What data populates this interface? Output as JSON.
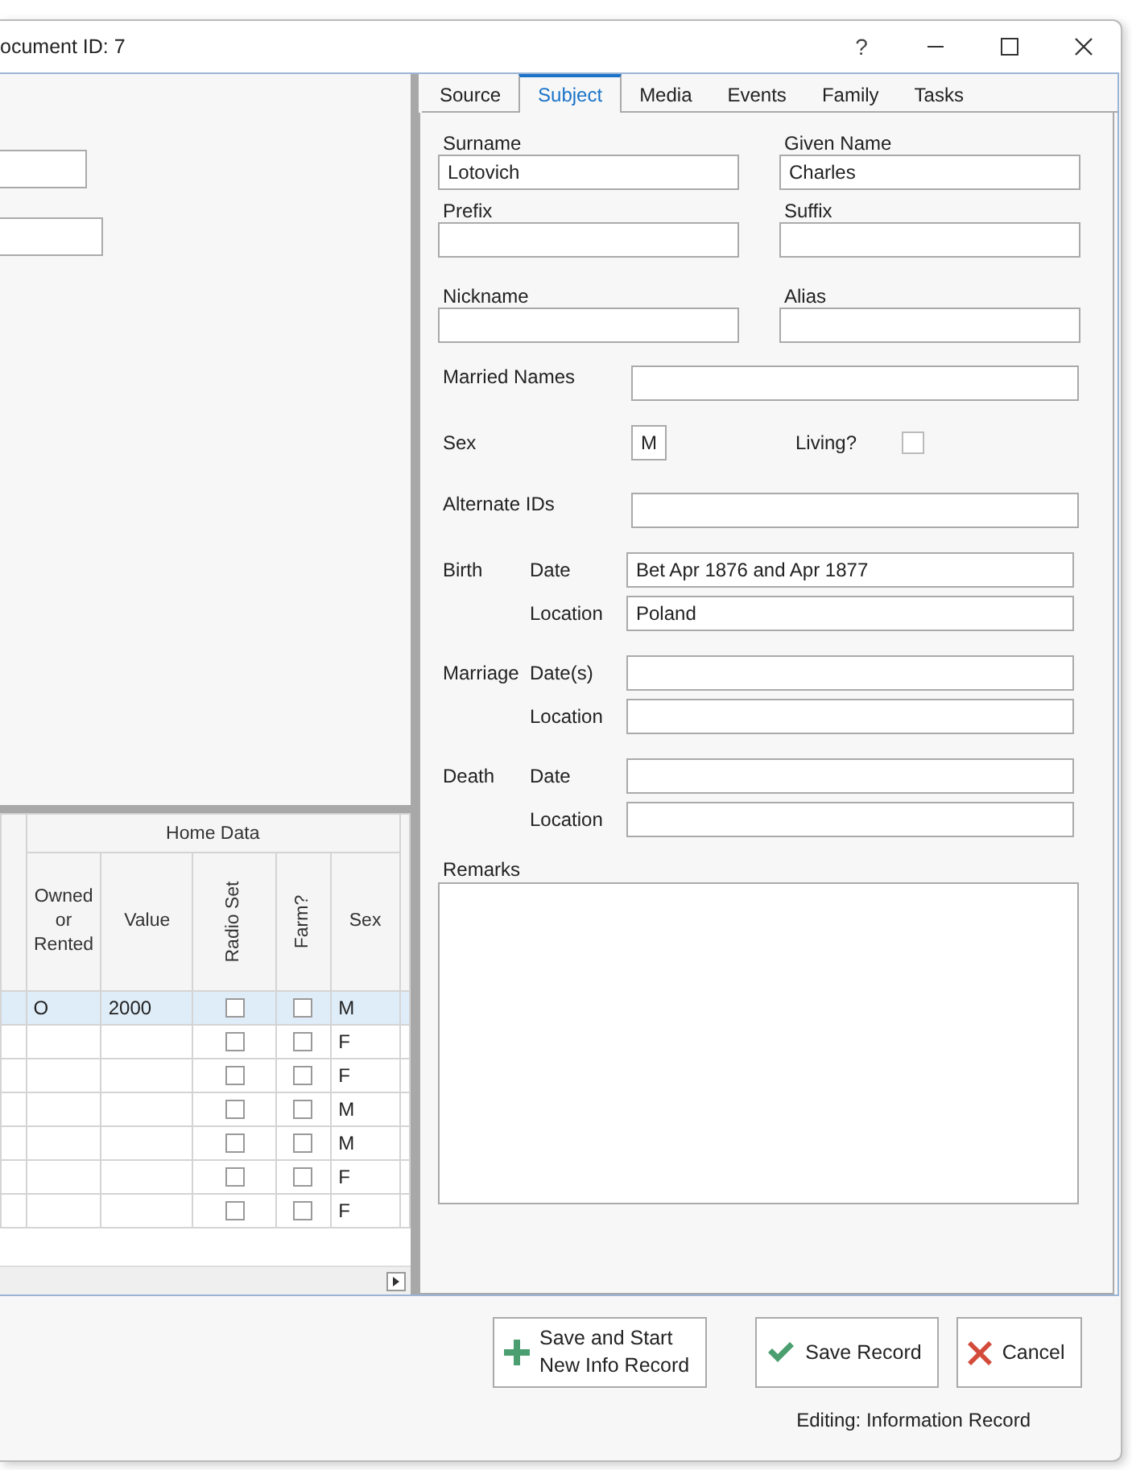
{
  "window": {
    "title": "ocument ID: 7",
    "help": "?"
  },
  "grid": {
    "group_header": "Home Data",
    "columns": [
      {
        "label": "Owned\nor\nRented",
        "kind": "text"
      },
      {
        "label": "Value",
        "kind": "text"
      },
      {
        "label": "Radio Set",
        "kind": "check"
      },
      {
        "label": "Farm?",
        "kind": "check"
      },
      {
        "label": "Sex",
        "kind": "text"
      }
    ],
    "rows": [
      {
        "selected": true,
        "cells": [
          {
            "text": "O"
          },
          {
            "text": "2000"
          },
          {
            "checked": false
          },
          {
            "checked": false
          },
          {
            "text": "M"
          }
        ]
      },
      {
        "selected": false,
        "cells": [
          {},
          {},
          {
            "checked": false
          },
          {
            "checked": false
          },
          {
            "text": "F"
          }
        ]
      },
      {
        "selected": false,
        "cells": [
          {},
          {},
          {
            "checked": false
          },
          {
            "checked": false
          },
          {
            "text": "F"
          }
        ]
      },
      {
        "selected": false,
        "cells": [
          {},
          {},
          {
            "checked": false
          },
          {
            "checked": false
          },
          {
            "text": "M"
          }
        ]
      },
      {
        "selected": false,
        "cells": [
          {},
          {},
          {
            "checked": false
          },
          {
            "checked": false
          },
          {
            "text": "M"
          }
        ]
      },
      {
        "selected": false,
        "cells": [
          {},
          {},
          {
            "checked": false
          },
          {
            "checked": false
          },
          {
            "text": "F"
          }
        ]
      },
      {
        "selected": false,
        "cells": [
          {},
          {},
          {
            "checked": false
          },
          {
            "checked": false
          },
          {
            "text": "F"
          }
        ]
      }
    ]
  },
  "tabs": [
    {
      "label": "Source",
      "selected": false
    },
    {
      "label": "Subject",
      "selected": true
    },
    {
      "label": "Media",
      "selected": false
    },
    {
      "label": "Events",
      "selected": false
    },
    {
      "label": "Family",
      "selected": false
    },
    {
      "label": "Tasks",
      "selected": false
    }
  ],
  "name_fields": [
    {
      "label": "Surname",
      "value": "Lotovich"
    },
    {
      "label": "Given Name",
      "value": "Charles"
    },
    {
      "label": "Prefix"
    },
    {
      "label": "Suffix"
    },
    {
      "label": "Nickname"
    },
    {
      "label": "Alias"
    }
  ],
  "married_names": {
    "label": "Married Names"
  },
  "sex": {
    "label": "Sex",
    "value": "M"
  },
  "living": {
    "label": "Living?",
    "checked": false
  },
  "alternate_ids": {
    "label": "Alternate IDs"
  },
  "events": [
    {
      "label": "Birth",
      "fields": [
        {
          "label": "Date",
          "value": "Bet Apr 1876 and Apr 1877"
        },
        {
          "label": "Location",
          "value": "Poland"
        }
      ]
    },
    {
      "label": "Marriage",
      "fields": [
        {
          "label": "Date(s)"
        },
        {
          "label": "Location"
        }
      ]
    },
    {
      "label": "Death",
      "fields": [
        {
          "label": "Date"
        },
        {
          "label": "Location"
        }
      ]
    }
  ],
  "remarks": {
    "label": "Remarks"
  },
  "buttons": [
    {
      "kind": "add",
      "label": "Save and Start\nNew Info Record"
    },
    {
      "kind": "save",
      "label": "Save Record"
    },
    {
      "kind": "cancel",
      "label": "Cancel"
    }
  ],
  "status": "Editing: Information Record"
}
